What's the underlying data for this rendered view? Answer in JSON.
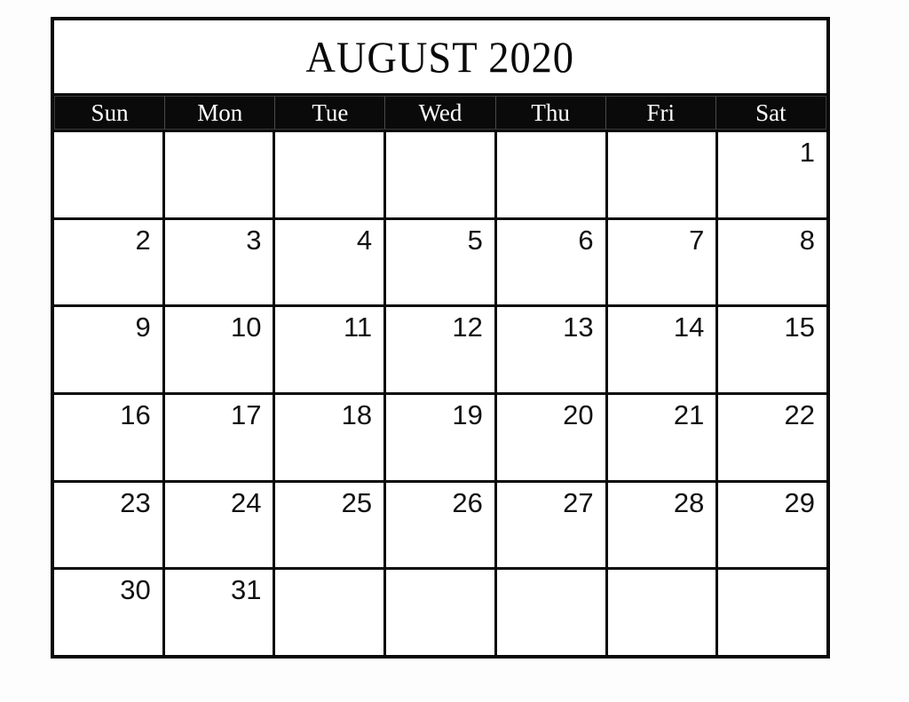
{
  "calendar": {
    "title": "AUGUST 2020",
    "month": "AUGUST",
    "year": "2020",
    "weekdays": [
      {
        "label": "Sun"
      },
      {
        "label": "Mon"
      },
      {
        "label": "Tue"
      },
      {
        "label": "Wed"
      },
      {
        "label": "Thu"
      },
      {
        "label": "Fri"
      },
      {
        "label": "Sat"
      }
    ],
    "weeks": [
      {
        "days": [
          {
            "date": ""
          },
          {
            "date": ""
          },
          {
            "date": ""
          },
          {
            "date": ""
          },
          {
            "date": ""
          },
          {
            "date": ""
          },
          {
            "date": "1"
          }
        ]
      },
      {
        "days": [
          {
            "date": "2"
          },
          {
            "date": "3"
          },
          {
            "date": "4"
          },
          {
            "date": "5"
          },
          {
            "date": "6"
          },
          {
            "date": "7"
          },
          {
            "date": "8"
          }
        ]
      },
      {
        "days": [
          {
            "date": "9"
          },
          {
            "date": "10"
          },
          {
            "date": "11"
          },
          {
            "date": "12"
          },
          {
            "date": "13"
          },
          {
            "date": "14"
          },
          {
            "date": "15"
          }
        ]
      },
      {
        "days": [
          {
            "date": "16"
          },
          {
            "date": "17"
          },
          {
            "date": "18"
          },
          {
            "date": "19"
          },
          {
            "date": "20"
          },
          {
            "date": "21"
          },
          {
            "date": "22"
          }
        ]
      },
      {
        "days": [
          {
            "date": "23"
          },
          {
            "date": "24"
          },
          {
            "date": "25"
          },
          {
            "date": "26"
          },
          {
            "date": "27"
          },
          {
            "date": "28"
          },
          {
            "date": "29"
          }
        ]
      },
      {
        "days": [
          {
            "date": "30"
          },
          {
            "date": "31"
          },
          {
            "date": ""
          },
          {
            "date": ""
          },
          {
            "date": ""
          },
          {
            "date": ""
          },
          {
            "date": ""
          }
        ]
      }
    ],
    "colors": {
      "grid_line": "#0a0a0a",
      "header_background": "#0a0a0a",
      "header_text": "#ffffff",
      "cell_background": "#ffffff",
      "page_background": "#fdfdfd",
      "date_text": "#111111"
    }
  }
}
